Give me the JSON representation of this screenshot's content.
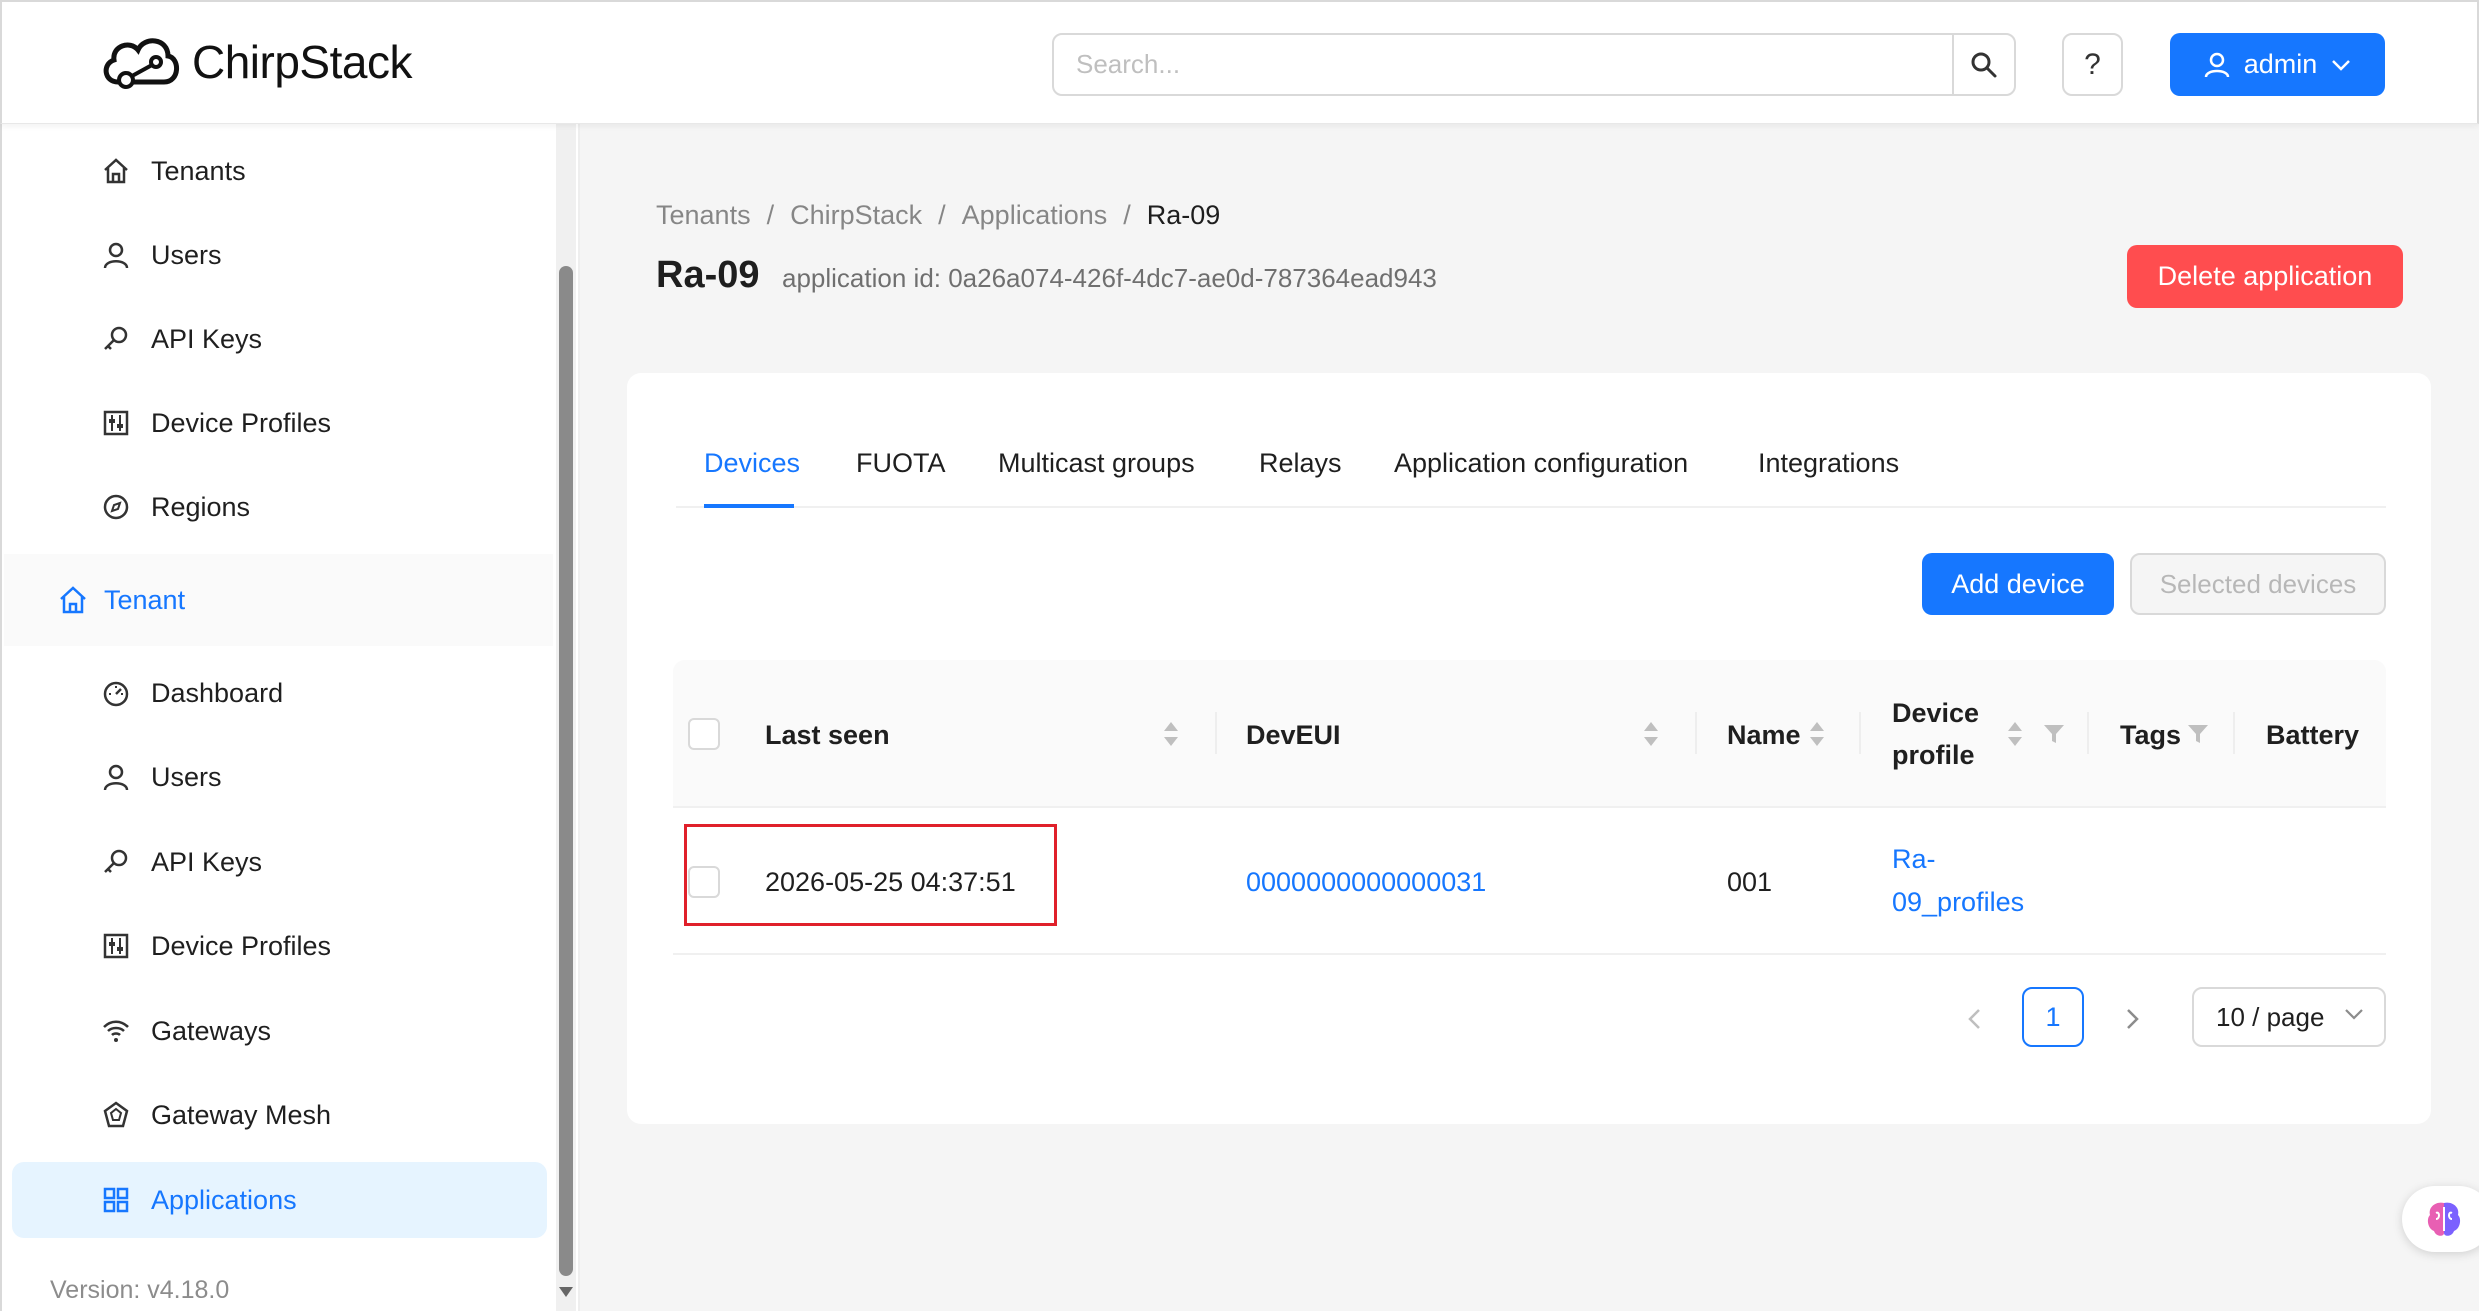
{
  "header": {
    "brand": "ChirpStack",
    "search_placeholder": "Search...",
    "help_label": "?",
    "user_label": "admin"
  },
  "sidebar": {
    "top_items": [
      {
        "label": "Tenants",
        "icon": "home-icon"
      },
      {
        "label": "Users",
        "icon": "user-icon"
      },
      {
        "label": "API Keys",
        "icon": "key-icon"
      },
      {
        "label": "Device Profiles",
        "icon": "sliders-icon"
      },
      {
        "label": "Regions",
        "icon": "compass-icon"
      }
    ],
    "group_label": "Tenant",
    "tenant_items": [
      {
        "label": "Dashboard",
        "icon": "dashboard-icon"
      },
      {
        "label": "Users",
        "icon": "user-icon"
      },
      {
        "label": "API Keys",
        "icon": "key-icon"
      },
      {
        "label": "Device Profiles",
        "icon": "sliders-icon"
      },
      {
        "label": "Gateways",
        "icon": "wifi-icon"
      },
      {
        "label": "Gateway Mesh",
        "icon": "mesh-icon"
      },
      {
        "label": "Applications",
        "icon": "grid-icon",
        "active": true
      }
    ],
    "version": "Version: v4.18.0"
  },
  "breadcrumb": [
    "Tenants",
    "ChirpStack",
    "Applications",
    "Ra-09"
  ],
  "page": {
    "title": "Ra-09",
    "subtitle": "application id: 0a26a074-426f-4dc7-ae0d-787364ead943",
    "delete_label": "Delete application"
  },
  "tabs": [
    "Devices",
    "FUOTA",
    "Multicast groups",
    "Relays",
    "Application configuration",
    "Integrations"
  ],
  "active_tab": "Devices",
  "actions": {
    "add_label": "Add device",
    "selected_label": "Selected devices"
  },
  "table": {
    "headers": {
      "last_seen": "Last seen",
      "dev_eui": "DevEUI",
      "name": "Name",
      "device_profile_1": "Device",
      "device_profile_2": "profile",
      "tags": "Tags",
      "battery": "Battery"
    },
    "rows": [
      {
        "last_seen": "2026-05-25 04:37:51",
        "dev_eui": "0000000000000031",
        "name": "001",
        "profile_1": "Ra-",
        "profile_2": "09_profiles",
        "tags": "",
        "battery": ""
      }
    ]
  },
  "pagination": {
    "current_page": "1",
    "page_size": "10 / page"
  },
  "colors": {
    "primary": "#1677ff",
    "danger": "#ff4d4f",
    "highlight_box": "#e0202a"
  }
}
